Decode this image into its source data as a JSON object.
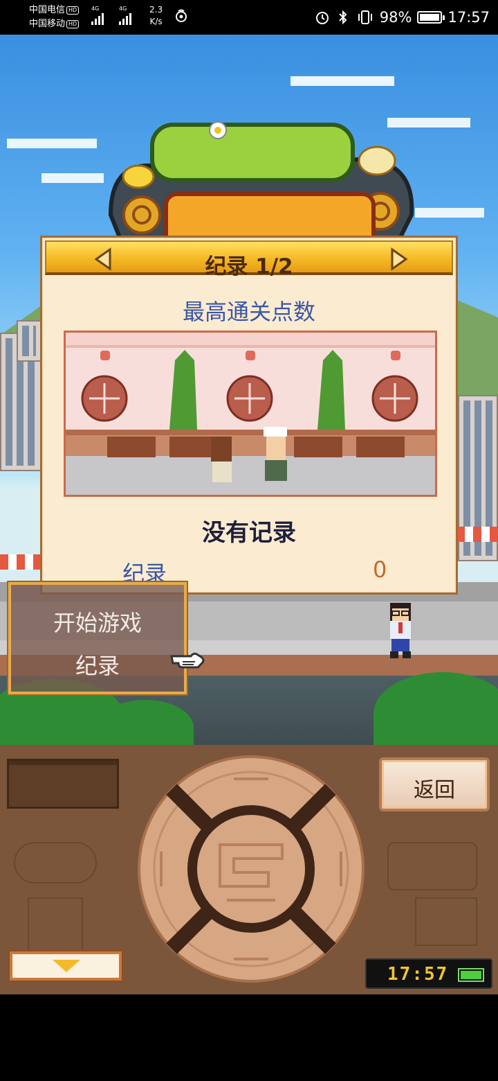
{
  "status_bar": {
    "carrier1": "中国电信",
    "carrier2": "中国移动",
    "hd_badge": "HD",
    "network_type": "4G",
    "net_speed_value": "2.3",
    "net_speed_unit": "K/s",
    "battery_percent": "98%",
    "time": "17:57",
    "icons": [
      "signal-icon",
      "alarm-icon",
      "bluetooth-icon",
      "vibrate-icon",
      "battery-icon"
    ]
  },
  "dialog": {
    "title": "纪录 1/2",
    "subtitle": "最高通关点数",
    "no_record_text": "没有记录",
    "record_label": "纪录",
    "record_value": "0"
  },
  "menu": {
    "items": [
      {
        "label": "开始游戏"
      },
      {
        "label": "纪录"
      }
    ]
  },
  "controls": {
    "back_label": "返回",
    "game_clock": "17:57"
  },
  "colors": {
    "dialog_bg": "#fbecd1",
    "header_gold": "#f5b925",
    "subtitle_blue": "#3b56a6",
    "value_orange": "#c46a2c",
    "controls_brown": "#7b563b"
  }
}
